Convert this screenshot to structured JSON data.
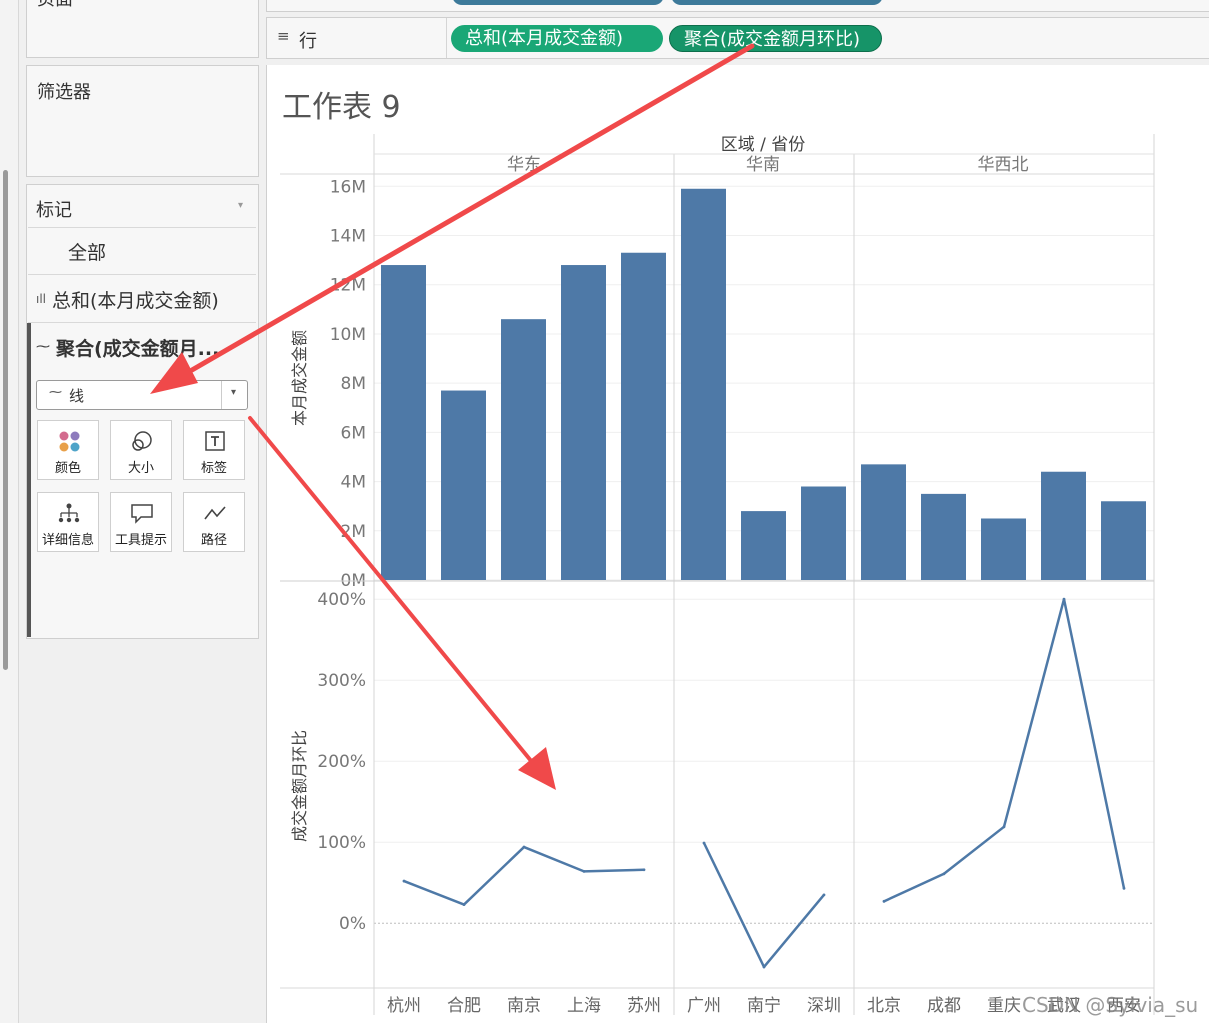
{
  "toolbar": {
    "top_clipped_label": "页面",
    "rows_label": "行",
    "row_pills": [
      "总和(本月成交金额)",
      "聚合(成交金额月环比)"
    ]
  },
  "filters": {
    "title": "筛选器"
  },
  "marks": {
    "title": "标记",
    "all_label": "全部",
    "layers": [
      "总和(本月成交金额)",
      "聚合(成交金额月..."
    ],
    "mark_type": "线",
    "buttons": [
      "颜色",
      "大小",
      "标签",
      "详细信息",
      "工具提示",
      "路径"
    ]
  },
  "worksheet": {
    "title": "工作表 9",
    "header": "区域 / 省份",
    "regions": [
      "华东",
      "华南",
      "华西北"
    ],
    "watermark": "CSDN @Sylvia_su"
  },
  "colors": {
    "bar": "#4e79a7",
    "line": "#4e79a7",
    "pill_green": "#1aa776",
    "pill_green_dark": "#169468",
    "arrow": "#f0494a"
  },
  "chart_data": [
    {
      "type": "bar",
      "ylabel": "本月成交金额",
      "categories": [
        "杭州",
        "合肥",
        "南京",
        "上海",
        "苏州",
        "广州",
        "南宁",
        "深圳",
        "北京",
        "成都",
        "重庆",
        "武汉",
        "西安"
      ],
      "groups": [
        {
          "name": "华东",
          "categories": [
            "杭州",
            "合肥",
            "南京",
            "上海",
            "苏州"
          ]
        },
        {
          "name": "华南",
          "categories": [
            "广州",
            "南宁",
            "深圳"
          ]
        },
        {
          "name": "华西北",
          "categories": [
            "北京",
            "成都",
            "重庆",
            "武汉",
            "西安"
          ]
        }
      ],
      "values": [
        12.8,
        7.7,
        10.6,
        12.8,
        13.3,
        15.9,
        2.8,
        3.8,
        4.7,
        3.5,
        2.5,
        4.4,
        3.2
      ],
      "yticks": [
        "0M",
        "2M",
        "4M",
        "6M",
        "8M",
        "10M",
        "12M",
        "14M",
        "16M"
      ],
      "ylim": [
        0,
        16.5
      ],
      "unit": "M",
      "grid": true
    },
    {
      "type": "line",
      "ylabel": "成交金额月环比",
      "categories": [
        "杭州",
        "合肥",
        "南京",
        "上海",
        "苏州",
        "广州",
        "南宁",
        "深圳",
        "北京",
        "成都",
        "重庆",
        "武汉",
        "西安"
      ],
      "segments": [
        {
          "name": "华东",
          "categories": [
            "杭州",
            "合肥",
            "南京",
            "上海",
            "苏州"
          ],
          "values": [
            52,
            23,
            94,
            64,
            66
          ]
        },
        {
          "name": "华南",
          "categories": [
            "广州",
            "南宁",
            "深圳"
          ],
          "values": [
            99,
            -54,
            35
          ]
        },
        {
          "name": "华西北",
          "categories": [
            "北京",
            "成都",
            "重庆",
            "武汉",
            "西安"
          ],
          "values": [
            27,
            61,
            119,
            400,
            43
          ]
        }
      ],
      "yticks": [
        "0%",
        "100%",
        "200%",
        "300%",
        "400%"
      ],
      "ylim": [
        -80,
        420
      ],
      "unit": "%",
      "grid": true
    }
  ]
}
